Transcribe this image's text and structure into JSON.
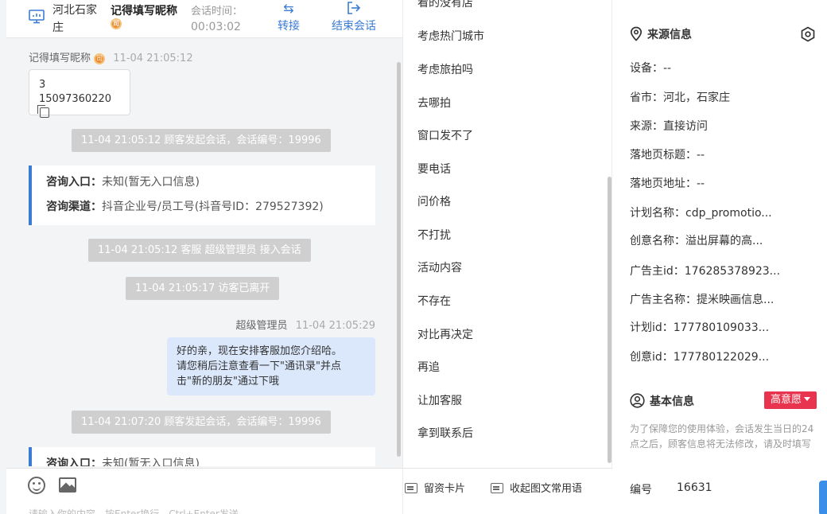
{
  "header": {
    "location": "河北石家庄",
    "nickname": "记得填写昵称",
    "session_time_label": "会话时间：",
    "session_time": "00:03:02",
    "transfer_label": "转接",
    "end_label": "结束会话",
    "vip_badge": "司",
    "accent": "#3a7bd5"
  },
  "messages": {
    "visitor_name": "记得填写昵称",
    "visitor_time": "11-04 21:05:12",
    "card_line1": "3",
    "card_line2": "15097360220",
    "sys1": "11-04 21:05:12 顾客发起会话，会话编号：19996",
    "card1_entry_key": "咨询入口：",
    "card1_entry_val": "未知(暂无入口信息)",
    "card1_channel_key": "咨询渠道：",
    "card1_channel_val": "抖音企业号/员工号(抖音号ID：279527392)",
    "sys2": "11-04 21:05:12 客服 超级管理员 接入会话",
    "sys3": "11-04 21:05:17 访客已离开",
    "agent_name": "超级管理员",
    "agent_time": "11-04 21:05:29",
    "agent_line1": "好的亲，现在安排客服加您介绍哈。",
    "agent_line2": "请您稍后注意查看一下\"通讯录\"并点",
    "agent_line3": "击\"新的朋友\"通过下哦",
    "sys4": "11-04 21:07:20 顾客发起会话，会话编号：19996",
    "card2_entry_key": "咨询入口：",
    "card2_entry_val": "未知(暂无入口信息)"
  },
  "footer": {
    "input_placeholder": "请输入你的内容，按Enter换行，Ctrl+Enter发送"
  },
  "phrases": {
    "items": [
      "看的没有店",
      "考虑热门城市",
      "考虑旅拍吗",
      "去哪拍",
      "窗口发不了",
      "要电话",
      "问价格",
      "不打扰",
      "活动内容",
      "不存在",
      "对比再决定",
      "再追",
      "让加客服",
      "拿到联系后"
    ],
    "card_button": "留资卡片",
    "collapse_button": "收起图文常用语"
  },
  "source_info": {
    "title": "来源信息",
    "device": "设备：--",
    "province_city": "省市：河北，石家庄",
    "source": "来源：直接访问",
    "landing_title": "落地页标题：--",
    "landing_url": "落地页地址：--",
    "plan_name": "计划名称：cdp_promotio...",
    "creative_name": "创意名称：溢出屏幕的高...",
    "advertiser_id": "广告主id：176285378923...",
    "advertiser_name": "广告主名称：提米映画信息...",
    "plan_id": "计划id：177780109033...",
    "creative_id": "创意id：177780122029..."
  },
  "basic_info": {
    "title": "基本信息",
    "intent_tag": "高意愿",
    "intent_color": "#e8344e",
    "hint": "为了保障您的使用体验，会话发生当日的24点之后，顾客信息将无法修改，请及时填写",
    "number_label": "编号",
    "number_value": "16631"
  }
}
